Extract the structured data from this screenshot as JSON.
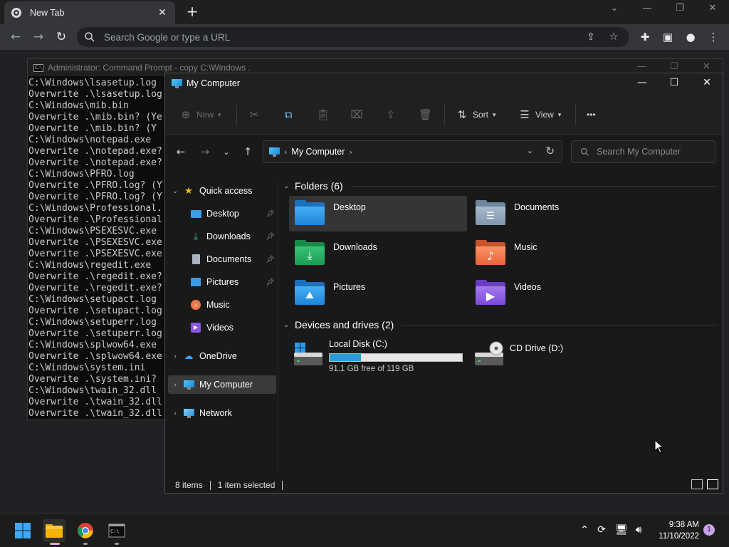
{
  "chrome": {
    "tab_title": "New Tab",
    "tab_close": "✕",
    "new_tab": "+",
    "omnibox_placeholder": "Search Google or type a URL"
  },
  "cmd": {
    "title": "Administrator: Command Prompt - copy  C:\\Windows .",
    "lines": [
      "C:\\Windows\\lsasetup.log",
      "Overwrite .\\lsasetup.log",
      "C:\\Windows\\mib.bin",
      "Overwrite .\\mib.bin? (Ye",
      "Overwrite .\\mib.bin? (Y",
      "C:\\Windows\\notepad.exe",
      "Overwrite .\\notepad.exe?",
      "Overwrite .\\notepad.exe?",
      "C:\\Windows\\PFRO.log",
      "Overwrite .\\PFRO.log? (Y",
      "Overwrite .\\PFRO.log? (Y",
      "C:\\Windows\\Professional.",
      "Overwrite .\\Professional",
      "C:\\Windows\\PSEXESVC.exe",
      "Overwrite .\\PSEXESVC.exe",
      "Overwrite .\\PSEXESVC.exe",
      "C:\\Windows\\regedit.exe",
      "Overwrite .\\regedit.exe?",
      "Overwrite .\\regedit.exe?",
      "C:\\Windows\\setupact.log",
      "Overwrite .\\setupact.log",
      "C:\\Windows\\setuperr.log",
      "Overwrite .\\setuperr.log",
      "C:\\Windows\\splwow64.exe",
      "Overwrite .\\splwow64.exe",
      "C:\\Windows\\system.ini",
      "Overwrite .\\system.ini?",
      "C:\\Windows\\twain_32.dll",
      "Overwrite .\\twain_32.dll",
      "Overwrite .\\twain_32.dll"
    ]
  },
  "explorer": {
    "title": "My Computer",
    "toolbar": {
      "new_label": "New",
      "sort_label": "Sort",
      "view_label": "View",
      "more_label": "•••"
    },
    "address": {
      "crumb": "My Computer",
      "search_placeholder": "Search My Computer"
    },
    "nav": {
      "quick_access": "Quick access",
      "desktop": "Desktop",
      "downloads": "Downloads",
      "documents": "Documents",
      "pictures": "Pictures",
      "music": "Music",
      "videos": "Videos",
      "onedrive": "OneDrive",
      "my_computer": "My Computer",
      "network": "Network"
    },
    "folders_header": "Folders (6)",
    "folders": {
      "desktop": "Desktop",
      "documents": "Documents",
      "downloads": "Downloads",
      "music": "Music",
      "pictures": "Pictures",
      "videos": "Videos"
    },
    "drives_header": "Devices and drives (2)",
    "drives": {
      "c_label": "Local Disk (C:)",
      "c_free": "91.1 GB free of 119 GB",
      "c_used_fraction": 0.234,
      "d_label": "CD Drive (D:)"
    },
    "status": {
      "items": "8 items",
      "selected": "1 item selected"
    }
  },
  "taskbar": {
    "time": "9:38 AM",
    "date": "11/10/2022",
    "notifications": "1"
  },
  "colors": {
    "accent": "#26a0da",
    "folder_blue": "#2f8fe0",
    "folder_green": "#22a35a",
    "folder_orange": "#f0764a",
    "folder_purple": "#8a55e0",
    "folder_gray": "#8aa0b8"
  }
}
